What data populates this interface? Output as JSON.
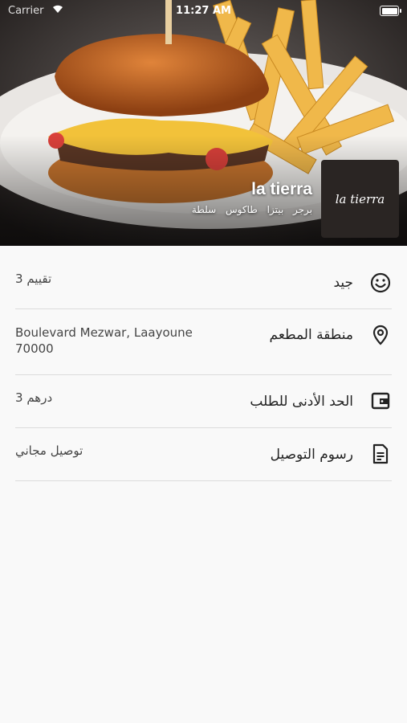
{
  "status_bar": {
    "carrier": "Carrier",
    "time": "11:27 AM"
  },
  "restaurant": {
    "name": "la tierra",
    "categories": [
      "برجر",
      "بيتزا",
      "طاكوس",
      "سلطة"
    ],
    "logo_text": "la tierra"
  },
  "details": [
    {
      "icon": "smiley-icon",
      "label": "جيد",
      "value": "تقييم 3"
    },
    {
      "icon": "location-pin-icon",
      "label": "منطقة المطعم",
      "value": "Boulevard Mezwar, Laayoune 70000"
    },
    {
      "icon": "wallet-icon",
      "label": "الحد الأدنى للطلب",
      "value": "درهم 3"
    },
    {
      "icon": "document-icon",
      "label": "رسوم التوصيل",
      "value": "توصيل مجاني"
    }
  ]
}
